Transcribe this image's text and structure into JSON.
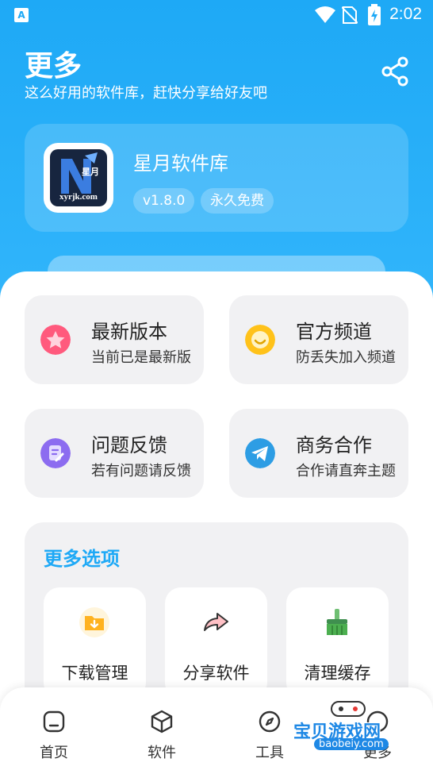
{
  "status_bar": {
    "time": "2:02",
    "left_icon": "A"
  },
  "header": {
    "title": "更多",
    "subtitle": "这么好用的软件库，赶快分享给好友吧"
  },
  "app": {
    "name": "星月软件库",
    "icon_text": "xyrjk.com",
    "icon_mark": "星月",
    "version": "v1.8.0",
    "license": "永久免费"
  },
  "tiles": [
    {
      "title": "最新版本",
      "subtitle": "当前已是最新版",
      "icon": "star-icon",
      "color": "#ff5a7d"
    },
    {
      "title": "官方频道",
      "subtitle": "防丢失加入频道",
      "icon": "smile-icon",
      "color": "#ffc21a"
    },
    {
      "title": "问题反馈",
      "subtitle": "若有问题请反馈",
      "icon": "edit-icon",
      "color": "#8c6cf0"
    },
    {
      "title": "商务合作",
      "subtitle": "合作请直奔主题",
      "icon": "telegram-icon",
      "color": "#2d9de4"
    }
  ],
  "more_options": {
    "title": "更多选项",
    "items": [
      {
        "label": "下载管理",
        "icon": "folder-download-icon"
      },
      {
        "label": "分享软件",
        "icon": "share-arrow-icon"
      },
      {
        "label": "清理缓存",
        "icon": "broom-icon"
      }
    ]
  },
  "nav": [
    {
      "label": "首页",
      "icon": "home-icon"
    },
    {
      "label": "软件",
      "icon": "cube-icon"
    },
    {
      "label": "工具",
      "icon": "compass-icon"
    },
    {
      "label": "更多",
      "icon": "more-icon"
    }
  ],
  "watermark": {
    "text": "宝贝游戏网",
    "url": "baobeiy.com"
  },
  "colors": {
    "accent": "#1ea9f6",
    "tile_bg": "#f1f1f3"
  }
}
